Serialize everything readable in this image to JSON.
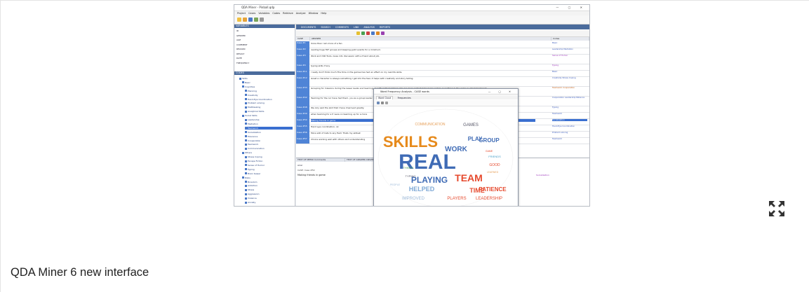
{
  "caption": "QDA Miner 6 new interface",
  "screenshot": {
    "window_title": "QDA Miner - Pinball.qdp",
    "window_controls": "— ▢ ✕",
    "menu": [
      "Project",
      "Cases",
      "Variables",
      "Codes",
      "Retrieve",
      "Analyze",
      "Window",
      "Help"
    ],
    "left_panel": {
      "variables_header": "VARIABLES",
      "variables": [
        "ID",
        "GENDER",
        "AGE",
        "COMMENT",
        "REASON",
        "RESULT",
        "DATE",
        "FREQUENCY"
      ],
      "codes_header": "CODES",
      "codes": [
        {
          "label": "Skills",
          "indent": 1
        },
        {
          "label": "Basic",
          "indent": 2
        },
        {
          "label": "Cognitive",
          "indent": 2
        },
        {
          "label": "Planning",
          "indent": 3
        },
        {
          "label": "Creativity",
          "indent": 3
        },
        {
          "label": "Hand-Eye Coordination",
          "indent": 3
        },
        {
          "label": "Problem solving",
          "indent": 3
        },
        {
          "label": "Multitasking",
          "indent": 3
        },
        {
          "label": "Analytical Skills",
          "indent": 3
        },
        {
          "label": "Social Skills",
          "indent": 2
        },
        {
          "label": "Leadership",
          "indent": 3
        },
        {
          "label": "Mediation",
          "indent": 3
        },
        {
          "label": "Teamwork",
          "indent": 3,
          "selected": true
        },
        {
          "label": "Socialization",
          "indent": 3
        },
        {
          "label": "Tolerance",
          "indent": 3
        },
        {
          "label": "Cooperation",
          "indent": 3
        },
        {
          "label": "Teamwork",
          "indent": 3
        },
        {
          "label": "Communication",
          "indent": 3
        },
        {
          "label": "Others",
          "indent": 2
        },
        {
          "label": "Stress Coping",
          "indent": 3
        },
        {
          "label": "Escape Fiction",
          "indent": 3
        },
        {
          "label": "Sense of Humor",
          "indent": 3
        },
        {
          "label": "Typing",
          "indent": 3
        },
        {
          "label": "Brain teaser",
          "indent": 3
        },
        {
          "label": "Risks",
          "indent": 2
        },
        {
          "label": "Boredom",
          "indent": 3
        },
        {
          "label": "Addiction",
          "indent": 3
        },
        {
          "label": "Stress",
          "indent": 3
        },
        {
          "label": "Aggression",
          "indent": 3
        },
        {
          "label": "Violence",
          "indent": 3
        },
        {
          "label": "Anxiety",
          "indent": 3
        }
      ]
    },
    "main_tabs": [
      "DOCUMENTS",
      "SEARCH",
      "COMMENTS",
      "LINK",
      "ANALYSIS",
      "REPORTS"
    ],
    "columns": [
      "CASE",
      "ANSWER",
      "Codes"
    ],
    "rows": [
      {
        "case": "Case #1",
        "text": "Since then I am more of a fan",
        "code": "Basic",
        "code_color": "#3354b8"
      },
      {
        "case": "Case #2",
        "text": "reading huge FAF groups and keeping guild events for a minimum.",
        "code": "Leadership Mediation",
        "code_color": "#3354b8"
      },
      {
        "case": "Case #3",
        "text": "Work and CSR Tools, Goes into discussion with a friend about job.",
        "code": "Sense of Humor",
        "code_color": "#9a2fb8"
      },
      {
        "case": "Case #4",
        "text": "typing skills if any",
        "code": "Typing",
        "code_color": "#9a2fb8"
      },
      {
        "case": "Case #11",
        "text": "I really don't think much.The time in the games has had an effect on my real life skills.",
        "code": "Basic",
        "code_color": "#3354b8"
      },
      {
        "case": "Case #12",
        "text": "Great a character is always something I get into the feel, it helps with creativity and story telling.",
        "code": "Creativity Stress Coping",
        "code_color": "#3354b8"
      },
      {
        "case": "Case #33",
        "text": "Grouping for missions during the lesser levels and teaming up with guild members who are more patient helped me realize everything in the game is about teamwork.",
        "code": "Teamwork Cooperation",
        "code_color": "#c05a10"
      },
      {
        "case": "Case #42",
        "text": "Teaming for the nor have had them, you as a group leader at that point and with the other members having the same ideas.",
        "code": "Cooperation Leadership Patience",
        "code_color": "#3354b8"
      },
      {
        "case": "Case #48",
        "text": "We only said the skill that I have improved greatly.",
        "code": "Typing",
        "code_color": "#3354b8"
      },
      {
        "case": "Case #49",
        "text": "when teaming for a fr were on teaming up for a more",
        "code": "Teamwork",
        "code_color": "#3354b8"
      },
      {
        "case": "Case #50",
        "text": "Making friends in game",
        "code": "Socialization",
        "code_color": "#ffffff",
        "highlight": true
      },
      {
        "case": "Case #55",
        "text": "Hand eye coordination, ok",
        "code": "Hand-Eye Coordination",
        "code_color": "#3354b8"
      },
      {
        "case": "Case #56",
        "text": "More skill of Cats to any field. Thats my skillset",
        "code": "Problem solving",
        "code_color": "#3354b8"
      },
      {
        "case": "Case #57",
        "text": "Choice working well with others and understanding",
        "code": "Teamwork",
        "code_color": "#3354b8"
      }
    ],
    "bottom": {
      "left_header": "TEXT OF MEMO Comments",
      "mid_header": "TEXT OF ANSWER ANSWER",
      "field_label": "Arial",
      "case_label": "CASE: Case #50",
      "memo_text": "Making friends in game",
      "right_code": "Socialization"
    },
    "popup": {
      "title": "Word Frequency Analysis - CASE words",
      "controls": "— ▢ ✕",
      "tabs": [
        "Word Cloud",
        "Frequencies"
      ],
      "words": [
        {
          "text": "SKILLS",
          "size": 22,
          "color": "#e68a1c"
        },
        {
          "text": "REAL",
          "size": 30,
          "color": "#3f6bb5"
        },
        {
          "text": "TEAM",
          "size": 14,
          "color": "#e64a2e"
        },
        {
          "text": "PLAYING",
          "size": 12,
          "color": "#3f6bb5"
        },
        {
          "text": "WORK",
          "size": 10,
          "color": "#3f6bb5"
        },
        {
          "text": "PLAY",
          "size": 8,
          "color": "#3f6bb5"
        },
        {
          "text": "GROUP",
          "size": 8,
          "color": "#3f6bb5"
        },
        {
          "text": "TIME",
          "size": 9,
          "color": "#e64a2e"
        },
        {
          "text": "HELPED",
          "size": 9,
          "color": "#7fa9d6"
        },
        {
          "text": "PATIENCE",
          "size": 8,
          "color": "#e64a2e"
        },
        {
          "text": "LEADERSHIP",
          "size": 6,
          "color": "#e64a2e"
        },
        {
          "text": "PLAYERS",
          "size": 6,
          "color": "#e64a2e"
        },
        {
          "text": "IMPROVED",
          "size": 6,
          "color": "#9bb8d8"
        },
        {
          "text": "COMMUNICATION",
          "size": 5,
          "color": "#e6a05a"
        },
        {
          "text": "GAMES",
          "size": 6,
          "color": "#556"
        },
        {
          "text": "GOOD",
          "size": 5,
          "color": "#e64a2e"
        },
        {
          "text": "FRIENDS",
          "size": 4,
          "color": "#4aa0c8"
        },
        {
          "text": "TYPING",
          "size": 4,
          "color": "#556"
        },
        {
          "text": "THINGS",
          "size": 4,
          "color": "#4aa060"
        },
        {
          "text": "LEARNED",
          "size": 3.5,
          "color": "#e6a05a"
        },
        {
          "text": "PEOPLE",
          "size": 3.5,
          "color": "#9bb8d8"
        },
        {
          "text": "GAME",
          "size": 3.5,
          "color": "#e64a2e"
        }
      ]
    }
  }
}
